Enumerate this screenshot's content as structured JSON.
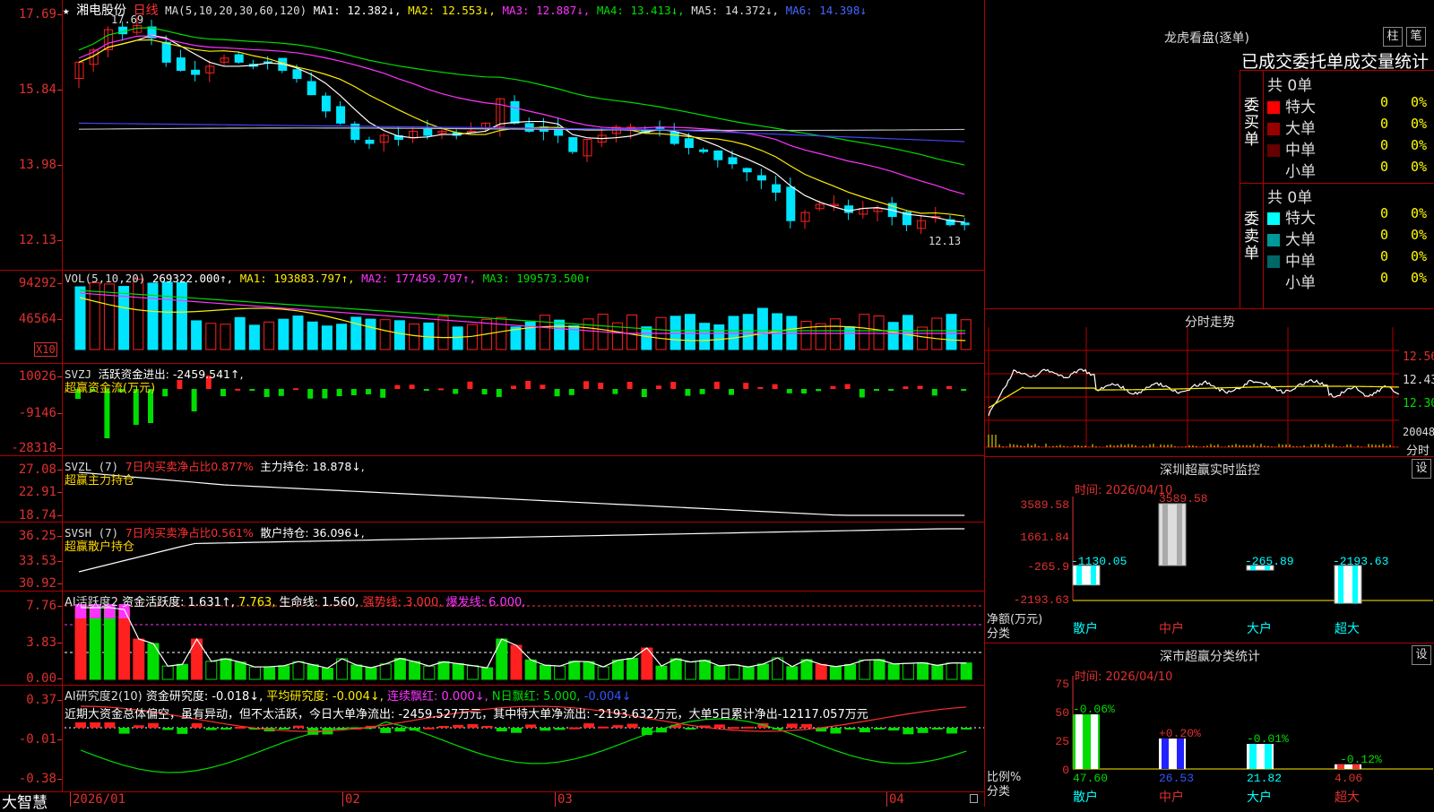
{
  "colors": {
    "up": "#ff2020",
    "down": "#00e5ff",
    "ma1": "#ffffff",
    "ma2": "#ffee00",
    "ma3": "#ff33ff",
    "ma4": "#00dd00",
    "ma5": "#bbbbbb",
    "ma6": "#4444ff",
    "bg": "#000000",
    "frame": "#b00000"
  },
  "main": {
    "star": "★",
    "stock_name": "湘电股份",
    "period": "日线",
    "ma_label": "MA(5,10,20,30,60,120)",
    "ma1": "MA1: 12.382↓,",
    "ma2": "MA2: 12.553↓,",
    "ma3": "MA3: 12.887↓,",
    "ma4": "MA4: 13.413↓,",
    "ma5": "MA5: 14.372↓,",
    "ma6": "MA6: 14.398↓",
    "ticks": [
      "17.69",
      "15.84",
      "13.98",
      "12.13"
    ],
    "high_label": "17.69",
    "low_label": "12.13"
  },
  "vol": {
    "label": "VOL(5,10,20)",
    "value": "269322.000↑,",
    "ma1": "MA1: 193883.797↑,",
    "ma2": "MA2: 177459.797↑,",
    "ma3": "MA3: 199573.500↑",
    "ticks": [
      "94292",
      "46564"
    ],
    "unit": "X10"
  },
  "svzj": {
    "label": "SVZJ",
    "desc": "活跃资金进出: -2459.541↑,",
    "sub": "超赢资金流(万元)",
    "ticks": [
      "10026",
      "-9146",
      "-28318"
    ]
  },
  "svzl": {
    "label": "SVZL (7)",
    "desc": "7日内买卖净占比0.877%",
    "pos": "主力持仓: 18.878↓,",
    "sub": "超赢主力持仓",
    "ticks": [
      "27.08",
      "22.91",
      "18.74"
    ]
  },
  "svsh": {
    "label": "SVSH (7)",
    "desc": "7日内买卖净占比0.561%",
    "pos": "散户持仓: 36.096↓,",
    "sub": "超赢散户持仓",
    "ticks": [
      "36.25",
      "33.53",
      "30.92"
    ]
  },
  "ai": {
    "label": "AI活跃度2",
    "fund": "资金活跃度: 1.631↑,",
    "v2": "7.763,",
    "life": "生命线: 1.560,",
    "strong": "强势线: 3.000,",
    "burst": "爆发线: 6.000,",
    "ticks": [
      "7.76",
      "3.83",
      "0.00"
    ]
  },
  "research": {
    "label": "AI研究度2(10)",
    "fund": "资金研究度: -0.018↓,",
    "avg": "平均研究度: -0.004↓,",
    "cont": "连续飘红: 0.000↓,",
    "nday": "N日飘红: 5.000,",
    "last": "-0.004↓",
    "comment": "近期大资金总体偏空，虽有异动，但不太活跃，今日大单净流出: -2459.527万元，其中特大单净流出: -2193.632万元，大单5日累计净出-12117.057万元",
    "ticks": [
      "0.37",
      "-0.01",
      "-0.38"
    ]
  },
  "xaxis": {
    "app": "大智慧",
    "labels": [
      "2026/01",
      "02",
      "03",
      "04"
    ]
  },
  "dragon": {
    "title": "龙虎看盘(逐单)",
    "tab1": "柱",
    "tab2": "笔",
    "subtitle": "已成交委托单成交量统计",
    "buy_total": "共 0单",
    "sell_total": "共 0单",
    "buy_side": "委买单",
    "sell_side": "委卖单",
    "buy_rows": [
      {
        "label": "特大",
        "value": "0",
        "pct": "0%",
        "color": "#ff0000"
      },
      {
        "label": "大单",
        "value": "0",
        "pct": "0%",
        "color": "#990000"
      },
      {
        "label": "中单",
        "value": "0",
        "pct": "0%",
        "color": "#660000"
      },
      {
        "label": "小单",
        "value": "0",
        "pct": "0%",
        "color": ""
      }
    ],
    "sell_rows": [
      {
        "label": "特大",
        "value": "0",
        "pct": "0%",
        "color": "#00ffff"
      },
      {
        "label": "大单",
        "value": "0",
        "pct": "0%",
        "color": "#009999"
      },
      {
        "label": "中单",
        "value": "0",
        "pct": "0%",
        "color": "#006666"
      },
      {
        "label": "小单",
        "value": "0",
        "pct": "0%",
        "color": ""
      }
    ]
  },
  "intraday": {
    "title": "分时走势",
    "ticks": [
      "12.56",
      "12.43",
      "12.30",
      "20048"
    ],
    "unit": "分时"
  },
  "monitor": {
    "title": "深圳超赢实时监控",
    "btn": "设",
    "time": "时间: 2026/04/10",
    "ticks": [
      "3589.58",
      "1661.84",
      "-265.9",
      "-2193.63"
    ],
    "ylabel": "净额(万元)",
    "xlabel": "分类",
    "cats": [
      "散户",
      "中户",
      "大户",
      "超大"
    ],
    "values": [
      -1130.05,
      3589.58,
      -265.89,
      -2193.63
    ],
    "value_labels": [
      "-1130.05",
      "3589.58",
      "-265.89",
      "-2193.63"
    ]
  },
  "stats": {
    "title": "深市超赢分类统计",
    "btn": "设",
    "time": "时间: 2026/04/10",
    "ticks": [
      "75",
      "50",
      "25",
      "0"
    ],
    "ylabel": "比例%",
    "xlabel": "分类",
    "cats": [
      "散户",
      "中户",
      "大户",
      "超大"
    ],
    "values": [
      47.6,
      26.53,
      21.82,
      4.06
    ],
    "value_labels": [
      "47.60",
      "26.53",
      "21.82",
      "4.06"
    ],
    "changes": [
      "-0.06%",
      "+0.20%",
      "-0.01%",
      "-0.12%"
    ]
  }
}
